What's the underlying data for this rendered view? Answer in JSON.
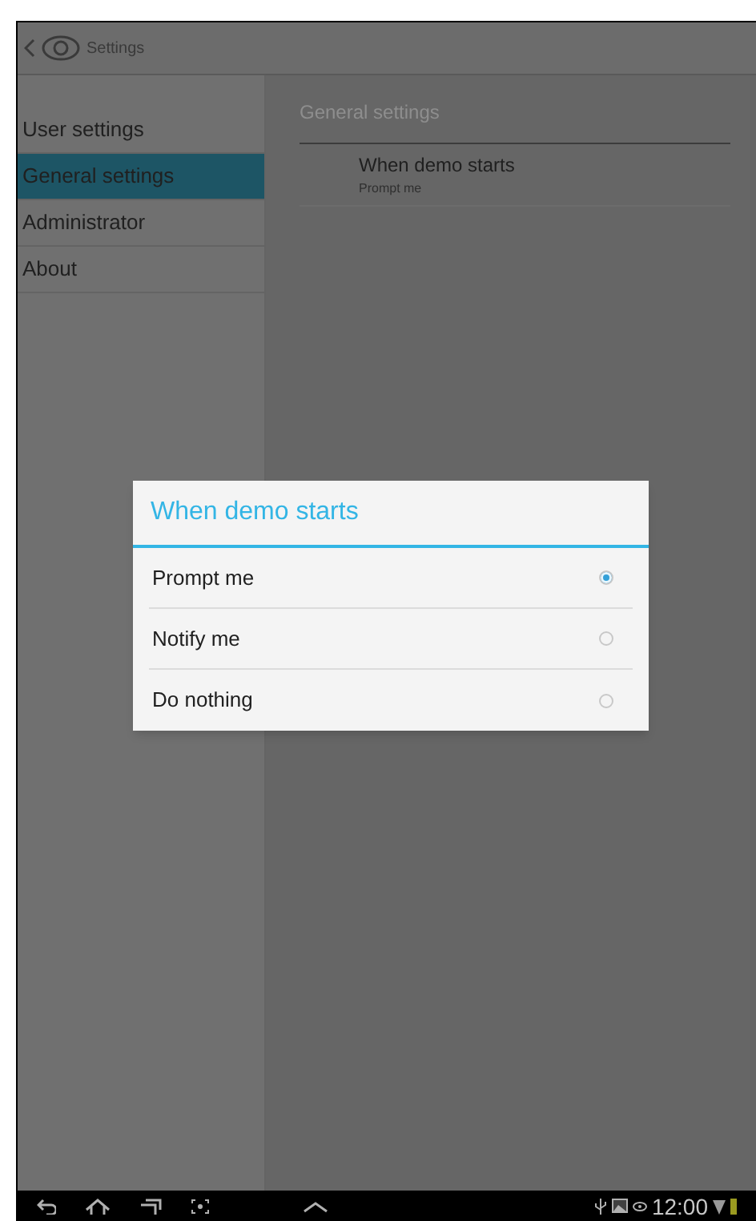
{
  "action_bar": {
    "title": "Settings"
  },
  "sidebar": {
    "items": [
      {
        "label": "User settings",
        "selected": false
      },
      {
        "label": "General settings",
        "selected": true
      },
      {
        "label": "Administrator",
        "selected": false
      },
      {
        "label": "About",
        "selected": false
      }
    ]
  },
  "content": {
    "header": "General settings",
    "items": [
      {
        "title": "When demo starts",
        "summary": "Prompt me"
      }
    ]
  },
  "dialog": {
    "title": "When demo starts",
    "options": [
      {
        "label": "Prompt me",
        "selected": true
      },
      {
        "label": "Notify me",
        "selected": false
      },
      {
        "label": "Do nothing",
        "selected": false
      }
    ]
  },
  "status_bar": {
    "time": "12:00"
  }
}
